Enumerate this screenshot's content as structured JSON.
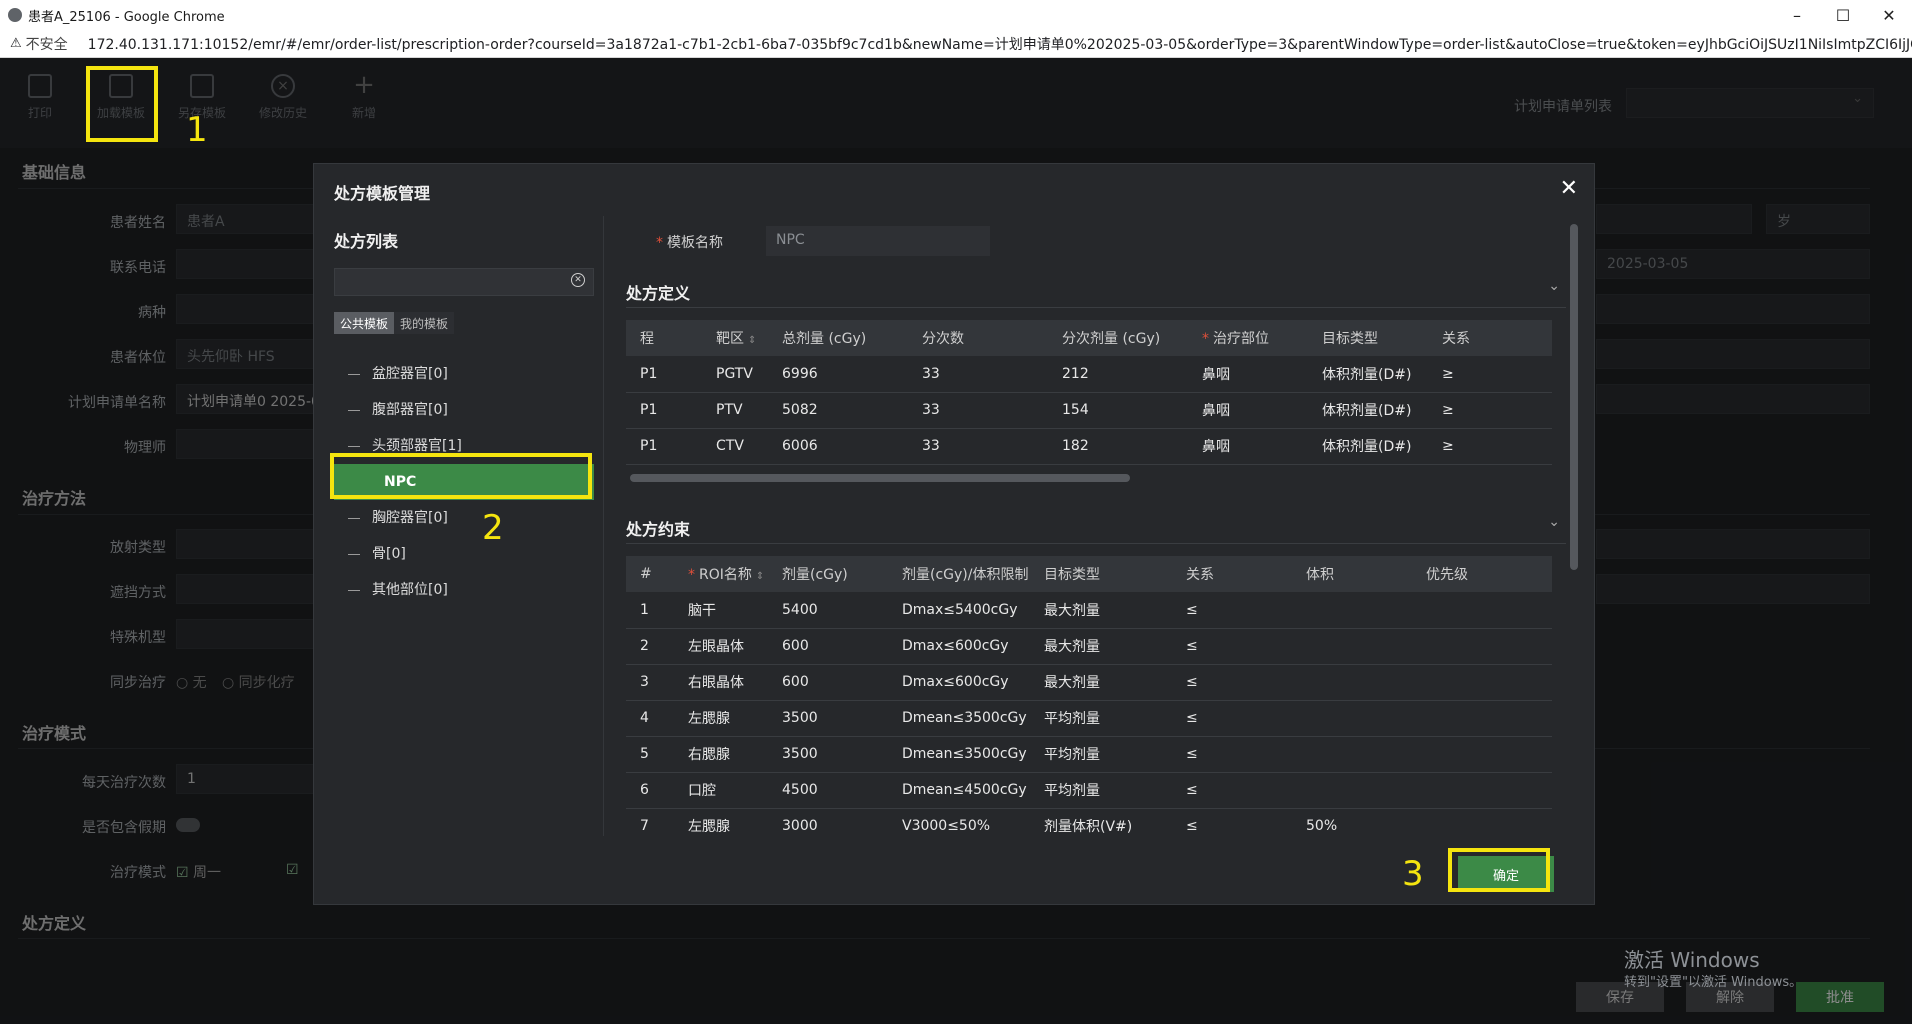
{
  "window": {
    "title": "患者A_25106 - Google Chrome",
    "controls": [
      "–",
      "☐",
      "✕"
    ],
    "security_label": "不安全",
    "url": "172.40.131.171:10152/emr/#/emr/order-list/prescription-order?courseId=3a1872a1-c7b1-2cb1-6ba7-035bf9c7cd1b&newName=计划申请单0%202025-03-05&orderType=3&parentWindowType=order-list&autoClose=true&token=eyJhbGciOiJSUzI1NiIsImtpZCI6IjJG..."
  },
  "toolbar": {
    "items": [
      {
        "label": "打印",
        "icon": "print-icon"
      },
      {
        "label": "加载模板",
        "icon": "load-template-icon"
      },
      {
        "label": "另存模板",
        "icon": "save-template-icon"
      },
      {
        "label": "修改历史",
        "icon": "history-icon"
      },
      {
        "label": "新增",
        "icon": "plus-icon"
      }
    ],
    "plan_list_label": "计划申请单列表"
  },
  "annotations": [
    "1",
    "2",
    "3"
  ],
  "background": {
    "sections": [
      "基础信息",
      "治疗方法",
      "治疗模式",
      "处方定义"
    ],
    "labels": [
      "患者姓名",
      "联系电话",
      "病种",
      "患者体位",
      "计划申请单名称",
      "物理师",
      "放射类型",
      "遮挡方式",
      "特殊机型",
      "同步治疗",
      "每天治疗次数",
      "是否包含假期",
      "治疗模式"
    ],
    "patient_name_placeholder": "患者A",
    "position_value": "头先仰卧 HFS",
    "plan_name_value": "计划申请单0 2025-0",
    "daily_count_value": "1",
    "sync_options": [
      "无",
      "同步化疗"
    ],
    "week_option": "周一",
    "age_unit": "岁",
    "date_value": "2025-03-05",
    "footer_buttons": [
      "保存",
      "解除",
      "批准"
    ],
    "watermark_title": "激活 Windows",
    "watermark_sub": "转到\"设置\"以激活 Windows。"
  },
  "modal": {
    "title": "处方模板管理",
    "close_label": "✕",
    "left": {
      "title": "处方列表",
      "search_placeholder": "",
      "tabs": [
        "公共模板",
        "我的模板"
      ],
      "tree": [
        {
          "label": "盆腔器官[0]",
          "level": 0,
          "selected": false
        },
        {
          "label": "腹部器官[0]",
          "level": 0,
          "selected": false
        },
        {
          "label": "头颈部器官[1]",
          "level": 0,
          "selected": false
        },
        {
          "label": "NPC",
          "level": 1,
          "selected": true
        },
        {
          "label": "胸腔器官[0]",
          "level": 0,
          "selected": false
        },
        {
          "label": "骨[0]",
          "level": 0,
          "selected": false
        },
        {
          "label": "其他部位[0]",
          "level": 0,
          "selected": false
        }
      ]
    },
    "right": {
      "template_name_label": "模板名称",
      "template_name_value": "NPC",
      "definition": {
        "title": "处方定义",
        "columns": [
          "程",
          "靶区",
          "总剂量 (cGy)",
          "分次数",
          "分次剂量 (cGy)",
          "治疗部位",
          "目标类型",
          "关系"
        ],
        "rows": [
          [
            "P1",
            "PGTV",
            "6996",
            "33",
            "212",
            "鼻咽",
            "体积剂量(D#)",
            "≥"
          ],
          [
            "P1",
            "PTV",
            "5082",
            "33",
            "154",
            "鼻咽",
            "体积剂量(D#)",
            "≥"
          ],
          [
            "P1",
            "CTV",
            "6006",
            "33",
            "182",
            "鼻咽",
            "体积剂量(D#)",
            "≥"
          ]
        ]
      },
      "constraints": {
        "title": "处方约束",
        "columns": [
          "#",
          "ROI名称",
          "剂量(cGy)",
          "剂量(cGy)/体积限制",
          "目标类型",
          "关系",
          "体积",
          "优先级"
        ],
        "rows": [
          [
            "1",
            "脑干",
            "5400",
            "Dmax≤5400cGy",
            "最大剂量",
            "≤",
            "",
            ""
          ],
          [
            "2",
            "左眼晶体",
            "600",
            "Dmax≤600cGy",
            "最大剂量",
            "≤",
            "",
            ""
          ],
          [
            "3",
            "右眼晶体",
            "600",
            "Dmax≤600cGy",
            "最大剂量",
            "≤",
            "",
            ""
          ],
          [
            "4",
            "左腮腺",
            "3500",
            "Dmean≤3500cGy",
            "平均剂量",
            "≤",
            "",
            ""
          ],
          [
            "5",
            "右腮腺",
            "3500",
            "Dmean≤3500cGy",
            "平均剂量",
            "≤",
            "",
            ""
          ],
          [
            "6",
            "口腔",
            "4500",
            "Dmean≤4500cGy",
            "平均剂量",
            "≤",
            "",
            ""
          ],
          [
            "7",
            "左腮腺",
            "3000",
            "V3000≤50%",
            "剂量体积(V#)",
            "≤",
            "50%",
            ""
          ]
        ]
      }
    },
    "confirm_label": "确定"
  },
  "colors": {
    "accent_green": "#3c8a47",
    "highlight_yellow": "#f5e50f"
  }
}
